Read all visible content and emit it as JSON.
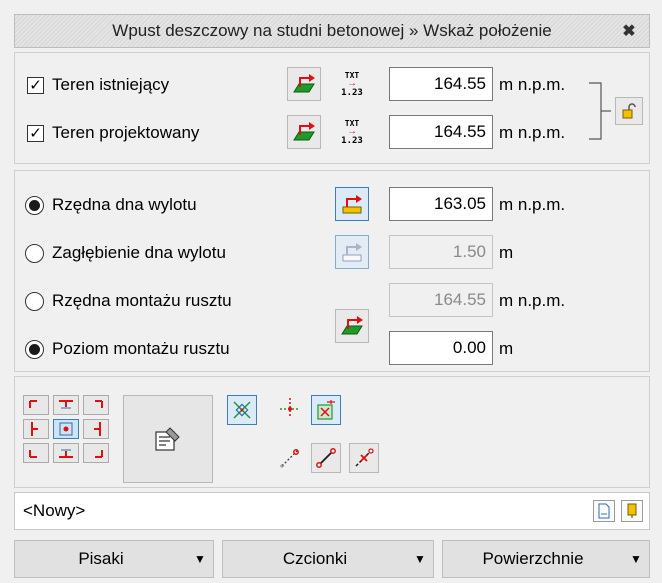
{
  "window": {
    "title": "Wpust deszczowy na studni betonowej » Wskaż położenie",
    "close_glyph": "✖"
  },
  "terrain": {
    "existing": {
      "label": "Teren istniejący",
      "checked": true,
      "value": "164.55",
      "unit": "m n.p.m."
    },
    "designed": {
      "label": "Teren projektowany",
      "checked": true,
      "value": "164.55",
      "unit": "m n.p.m."
    },
    "txt_icon_top": "TXT",
    "txt_icon_bottom": "1.23"
  },
  "levels": {
    "outlet_bottom": {
      "label": "Rzędna dna wylotu",
      "selected": true,
      "value": "163.05",
      "unit": "m n.p.m."
    },
    "outlet_depth": {
      "label": "Zagłębienie dna wylotu",
      "selected": false,
      "value": "1.50",
      "unit": "m"
    },
    "grate_elevation": {
      "label": "Rzędna montażu rusztu",
      "selected": false,
      "value": "164.55",
      "unit": "m n.p.m."
    },
    "grate_level": {
      "label": "Poziom montażu rusztu",
      "selected": true,
      "value": "0.00",
      "unit": "m"
    }
  },
  "style_combo": {
    "value": "<Nowy>"
  },
  "bottom_buttons": {
    "pens": "Pisaki",
    "fonts": "Czcionki",
    "surfaces": "Powierzchnie"
  },
  "colors": {
    "accent_red": "#e01010",
    "accent_green": "#1e9a2a",
    "accent_blue": "#2b6cb0",
    "accent_yellow": "#f2c200"
  }
}
